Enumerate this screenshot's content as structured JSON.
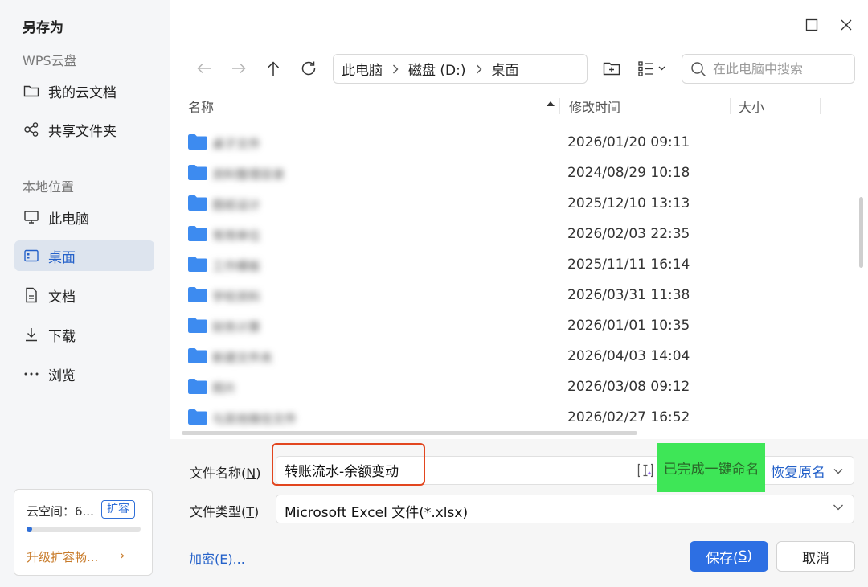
{
  "dialog": {
    "title": "另存为"
  },
  "sidebar": {
    "cloud_section": "WPS云盘",
    "cloud_items": [
      {
        "label": "我的云文档",
        "icon": "folder-icon"
      },
      {
        "label": "共享文件夹",
        "icon": "share-icon"
      }
    ],
    "local_section": "本地位置",
    "local_items": [
      {
        "label": "此电脑",
        "icon": "monitor-icon",
        "active": false
      },
      {
        "label": "桌面",
        "icon": "desktop-icon",
        "active": true
      },
      {
        "label": "文档",
        "icon": "document-icon",
        "active": false
      },
      {
        "label": "下载",
        "icon": "download-icon",
        "active": false
      },
      {
        "label": "浏览",
        "icon": "more-icon",
        "active": false
      }
    ],
    "cloud_card": {
      "label": "云空间：6...",
      "expand_label": "扩容",
      "usage_fraction": 0.05,
      "upgrade_label": "升级扩容畅..."
    }
  },
  "toolbar": {
    "breadcrumbs": [
      "此电脑",
      "磁盘 (D:)",
      "桌面"
    ],
    "search_placeholder": "在此电脑中搜索"
  },
  "file_list": {
    "columns": {
      "name": "名称",
      "modified": "修改时间",
      "size": "大小"
    },
    "rows": [
      {
        "name": "桌子文件",
        "modified": "2026/01/20 09:11"
      },
      {
        "name": "资料整理目录",
        "modified": "2024/08/29 10:18"
      },
      {
        "name": "图纸设计",
        "modified": "2025/12/10 13:13"
      },
      {
        "name": "常用单位",
        "modified": "2026/02/03 22:35"
      },
      {
        "name": "工作模板",
        "modified": "2025/11/11 16:14"
      },
      {
        "name": "学校资料",
        "modified": "2026/03/31 11:38"
      },
      {
        "name": "财务计算",
        "modified": "2026/01/01 10:35"
      },
      {
        "name": "新建文件夹",
        "modified": "2026/04/03 14:04"
      },
      {
        "name": "照片",
        "modified": "2026/03/08 09:12"
      },
      {
        "name": "与其他微信文件",
        "modified": "2026/02/27 16:52"
      }
    ]
  },
  "form": {
    "filename_label": "文件名称(",
    "filename_key": "N",
    "filename_value": "转账流水-余额变动",
    "ai_status": "已完成一键命名",
    "restore_label": "恢复原名",
    "filetype_label": "文件类型(",
    "filetype_key": "T",
    "filetype_value": "Microsoft Excel 文件(*.xlsx)",
    "encrypt_label": "加密(E)...",
    "save_label": "保存(",
    "save_key": "S",
    "cancel_label": "取消"
  },
  "colors": {
    "accent": "#2d6fe3",
    "highlight_border": "#e2461f",
    "status_bg": "#3ee657",
    "upgrade": "#c87b2a"
  }
}
